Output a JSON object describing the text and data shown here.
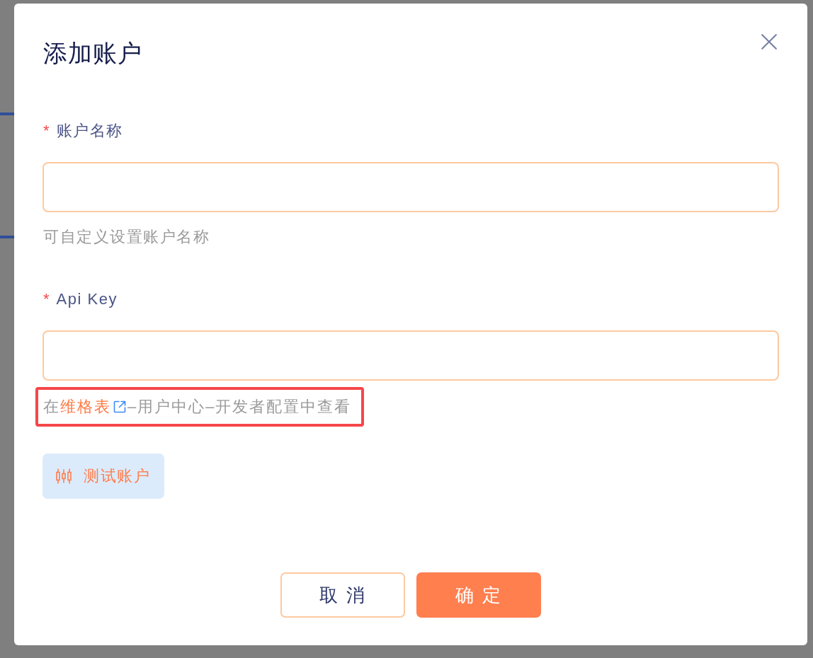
{
  "dialog": {
    "title": "添加账户"
  },
  "fields": [
    {
      "required_mark": "*",
      "label": "账户名称",
      "hint": {
        "text": "可自定义设置账户名称",
        "highlighted": false
      }
    },
    {
      "required_mark": "*",
      "label": "Api Key",
      "hint": {
        "text": "在",
        "link": "维格表",
        "text_after": "–用户中心–开发者配置中查看",
        "highlighted": true
      }
    }
  ],
  "test_button": {
    "label": "测试账户"
  },
  "footer_buttons": [
    {
      "label": "取 消",
      "kind": "secondary"
    },
    {
      "label": "确 定",
      "kind": "primary"
    }
  ]
}
